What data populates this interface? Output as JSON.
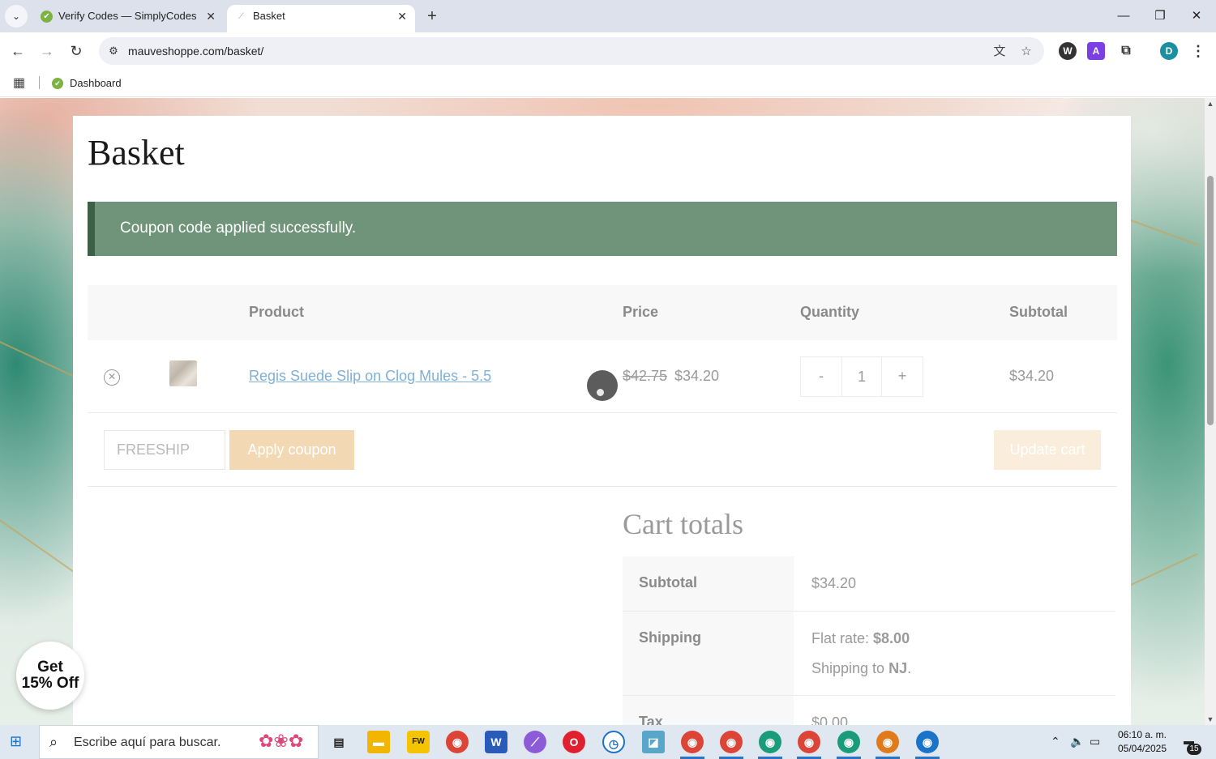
{
  "browser": {
    "tabs": [
      {
        "title": "Verify Codes — SimplyCodes",
        "active": false
      },
      {
        "title": "Basket",
        "active": true
      }
    ],
    "url": "mauveshoppe.com/basket/",
    "bookmarks": [
      {
        "label": "Dashboard"
      }
    ],
    "profile_initial": "D"
  },
  "page": {
    "title": "Basket",
    "notice": "Coupon code applied successfully.",
    "cart": {
      "headers": {
        "product": "Product",
        "price": "Price",
        "quantity": "Quantity",
        "subtotal": "Subtotal"
      },
      "items": [
        {
          "name": "Regis Suede Slip on Clog Mules - 5.5",
          "old_price": "$42.75",
          "price": "$34.20",
          "minus": "-",
          "quantity": "1",
          "plus": "+",
          "subtotal": "$34.20"
        }
      ]
    },
    "coupon": {
      "value": "FREESHIP",
      "apply_label": "Apply coupon"
    },
    "update_label": "Update cart",
    "totals": {
      "title": "Cart totals",
      "subtotal_label": "Subtotal",
      "subtotal_value": "$34.20",
      "shipping_label": "Shipping",
      "shipping_method": "Flat rate: ",
      "shipping_cost": "$8.00",
      "shipping_to_prefix": "Shipping to ",
      "shipping_state": "NJ",
      "shipping_to_suffix": ".",
      "tax_label": "Tax",
      "tax_value": "$0.00"
    },
    "promo": {
      "line1": "Get",
      "line2": "15% Off"
    }
  },
  "taskbar": {
    "search_placeholder": "Escribe aquí para buscar.",
    "time": "06:10 a. m.",
    "date": "05/04/2025",
    "notification_count": "15"
  },
  "colors": {
    "notice_bg": "#6f9479",
    "notice_border": "#3d5e47",
    "apply_button": "#f3d9b3",
    "update_button": "#faeddc",
    "product_link": "#7fb0d8"
  }
}
